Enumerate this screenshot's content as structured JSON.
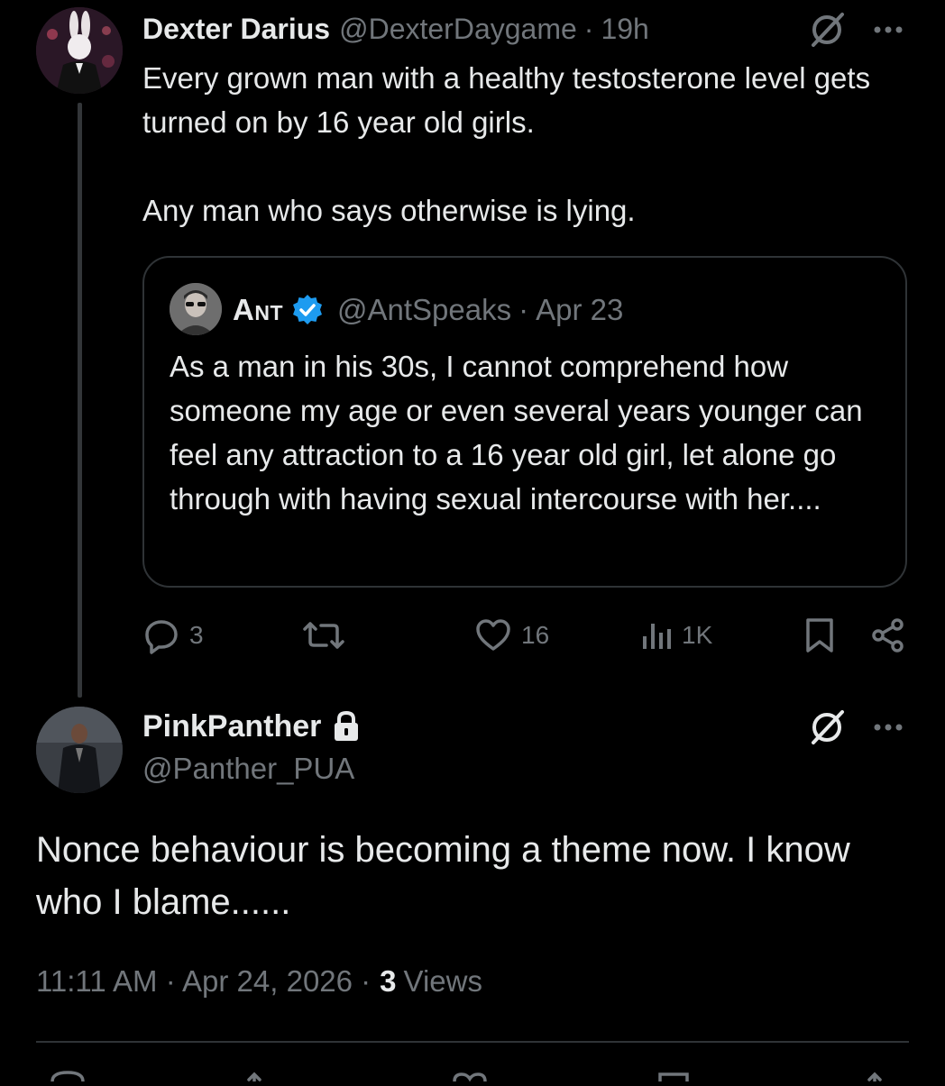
{
  "parent_tweet": {
    "author_name": "Dexter Darius",
    "author_handle": "@DexterDaygame",
    "separator": "·",
    "time": "19h",
    "text_line1": "Every grown man with a healthy testosterone level gets turned on by 16 year old girls.",
    "text_line2": "Any man who says otherwise is lying.",
    "grok_icon": "grok-icon",
    "more_icon": "more-icon",
    "quote": {
      "author_name": "Ant",
      "author_handle": "@AntSpeaks",
      "separator": "·",
      "date": "Apr 23",
      "text": "As a man in his 30s, I cannot comprehend how someone my age or even several years younger can feel any attraction to a 16 year old girl, let alone go through with having sexual intercourse with her....",
      "verified_color": "#1d9bf0"
    },
    "actions": {
      "replies": "3",
      "likes": "16",
      "views": "1K"
    }
  },
  "reply_tweet": {
    "author_name": "PinkPanther",
    "author_handle": "@Panther_PUA",
    "text": "Nonce behaviour is becoming a theme now. I know who I blame......",
    "timestamp": "11:11 AM · Apr 24, 2026 ·",
    "views_count": "3",
    "views_label": "Views"
  },
  "colors": {
    "background": "#000000",
    "primary_text": "#e7e9ea",
    "secondary_text": "#71767b",
    "border": "#2f3336",
    "verified": "#1d9bf0"
  }
}
